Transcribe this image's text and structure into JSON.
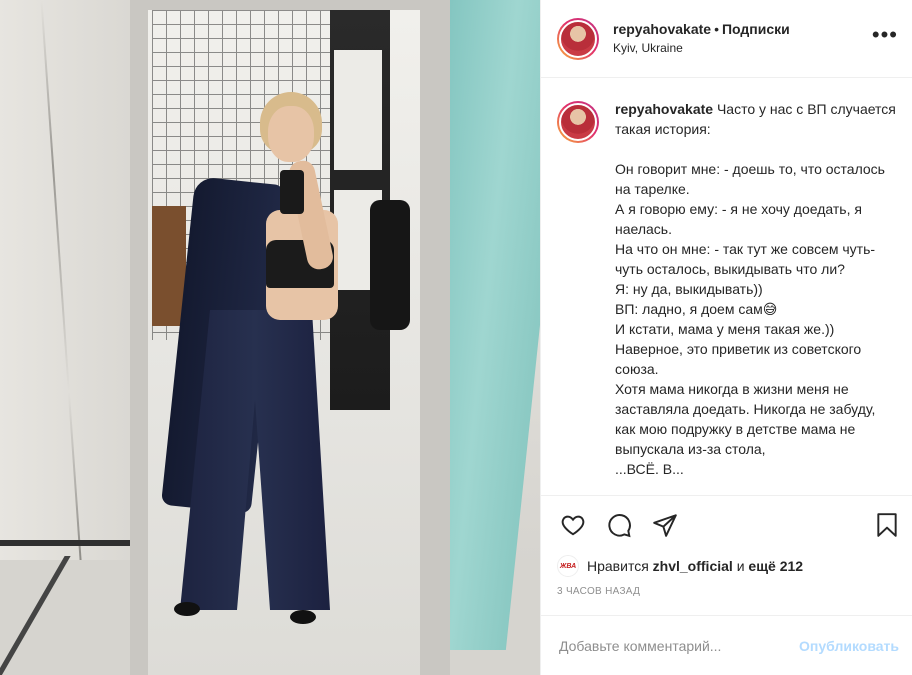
{
  "post": {
    "username": "repyahovakate",
    "dot": "•",
    "follow_label": "Подписки",
    "location": "Kyiv, Ukraine",
    "more_label": "•••",
    "caption_lines": [
      "Часто у нас с ВП случается такая история:",
      "",
      "Он говорит мне: - доешь то, что осталось на тарелке.",
      "А я говорю ему: - я не хочу доедать, я наелась.",
      "На что он мне: - так тут же совсем чуть-чуть осталось, выкидывать что ли?",
      "Я: ну да, выкидывать))",
      "ВП: ладно, я доем сам😅",
      "И кстати, мама у меня такая же.))",
      "Наверное, это приветик из советского союза.",
      "Хотя мама никогда в жизни меня не заставляла доедать. Никогда не забуду, как мою подружку в детстве мама не выпускала из-за стола,",
      "...ВСЁ. В..."
    ],
    "likes": {
      "avatar_text": "ЖВА",
      "prefix": "Нравится",
      "user": "zhvl_official",
      "and": "и",
      "others": "ещё 212"
    },
    "time": "3 часов назад",
    "comment_placeholder": "Добавьте комментарий...",
    "publish_label": "Опубликовать",
    "colors": {
      "accent_disabled": "#b3dbff",
      "text": "#262626",
      "muted": "#8e8e8e"
    },
    "icons": [
      "heart-icon",
      "comment-icon",
      "share-icon",
      "bookmark-icon"
    ]
  }
}
